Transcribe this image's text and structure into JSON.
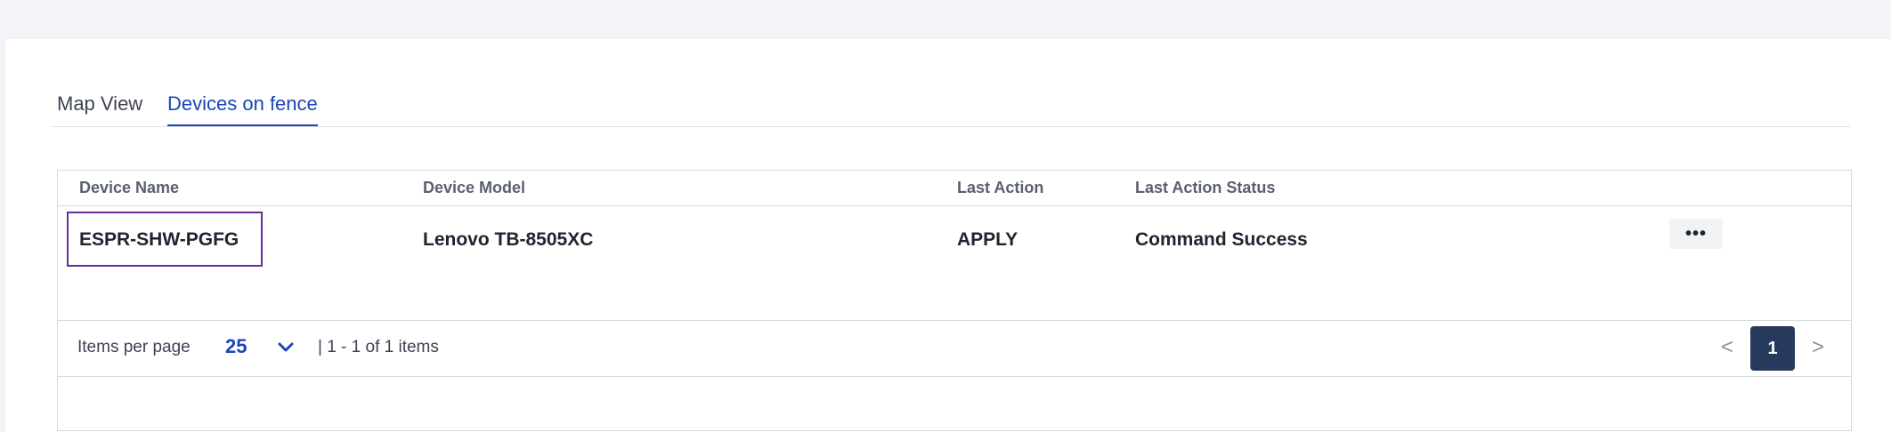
{
  "tabs": [
    {
      "label": "Map View"
    },
    {
      "label": "Devices on fence"
    }
  ],
  "table": {
    "headers": [
      "Device Name",
      "Device Model",
      "Last Action",
      "Last Action Status"
    ],
    "rows": [
      {
        "device_name": "ESPR-SHW-PGFG",
        "device_model": "Lenovo TB-8505XC",
        "last_action": "APPLY",
        "last_action_status": "Command Success",
        "more_label": "•••"
      }
    ]
  },
  "pagination": {
    "items_per_page_label": "Items per page",
    "items_per_page_value": "25",
    "range_text": "| 1 - 1 of 1 items",
    "prev_glyph": "<",
    "next_glyph": ">",
    "current_page": "1"
  },
  "colors": {
    "accent": "#1b46b8",
    "highlight_border": "#6b2a9a",
    "page_active_bg": "#253a5c"
  }
}
